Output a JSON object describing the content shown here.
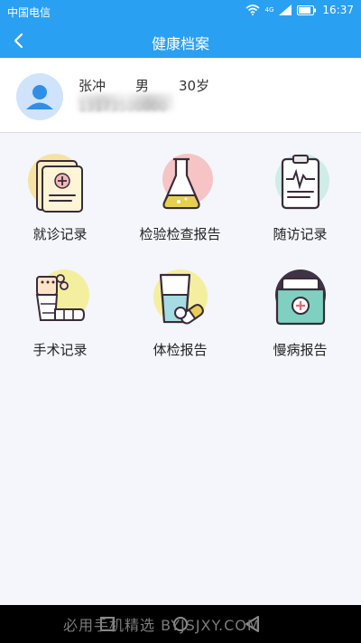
{
  "status_bar": {
    "carrier": "中国电信",
    "network_badge": "4G",
    "time": "16:37",
    "icons": [
      "wifi-icon",
      "signal-icon",
      "battery-icon"
    ]
  },
  "header": {
    "title": "健康档案",
    "back_icon": "chevron-left-icon"
  },
  "profile": {
    "name": "张冲",
    "gender": "男",
    "age": "30岁",
    "phone": "13173500000"
  },
  "features": [
    {
      "label": "就诊记录",
      "icon": "medical-record-icon"
    },
    {
      "label": "检验检查报告",
      "icon": "lab-flask-icon"
    },
    {
      "label": "随访记录",
      "icon": "clipboard-ecg-icon"
    },
    {
      "label": "手术记录",
      "icon": "bandage-arm-icon"
    },
    {
      "label": "体检报告",
      "icon": "water-glass-pill-icon"
    },
    {
      "label": "慢病报告",
      "icon": "medical-folder-icon"
    }
  ],
  "watermark": "必用手机精选 BYJSJXY.COM",
  "colors": {
    "header_bg": "#2aa0f2",
    "page_bg": "#f4f6fb",
    "nav_bg": "#000000"
  }
}
